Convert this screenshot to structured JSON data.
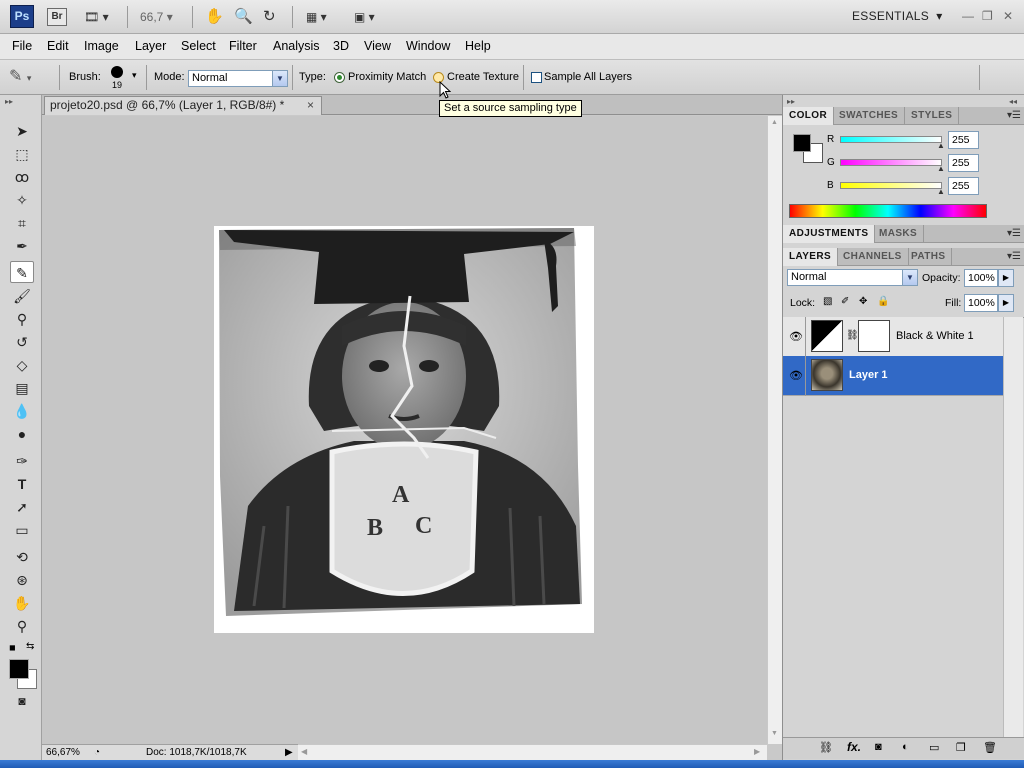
{
  "app": {
    "logo": "Ps",
    "bridge": "Br",
    "zoom_display": "66,7",
    "workspace": "ESSENTIALS",
    "icons": [
      "film-icon",
      "hand-icon",
      "zoom-icon",
      "rotate-view-icon",
      "arrange-icon",
      "screen-mode-icon"
    ],
    "window_buttons": [
      "minimize",
      "restore",
      "close"
    ]
  },
  "menu": [
    "File",
    "Edit",
    "Image",
    "Layer",
    "Select",
    "Filter",
    "Analysis",
    "3D",
    "View",
    "Window",
    "Help"
  ],
  "options": {
    "brush_label": "Brush:",
    "brush_size": "19",
    "mode_label": "Mode:",
    "mode_value": "Normal",
    "type_label": "Type:",
    "proximity": "Proximity Match",
    "texture": "Create Texture",
    "sample_all": "Sample All Layers",
    "tooltip": "Set a source sampling type"
  },
  "document": {
    "tab_title": "projeto20.psd @ 66,7% (Layer 1, RGB/8#) *",
    "zoom": "66,67%",
    "doc_info": "Doc: 1018,7K/1018,7K",
    "photo_letters": [
      "A",
      "B",
      "C"
    ]
  },
  "panels": {
    "color_tabs": [
      "COLOR",
      "SWATCHES",
      "STYLES"
    ],
    "rgb": [
      {
        "label": "R",
        "value": "255",
        "color": "#00dede"
      },
      {
        "label": "G",
        "value": "255",
        "color": "#e000e0"
      },
      {
        "label": "B",
        "value": "255",
        "color": "#e0e000"
      }
    ],
    "adj_tabs": [
      "ADJUSTMENTS",
      "MASKS"
    ],
    "layer_tabs": [
      "LAYERS",
      "CHANNELS",
      "PATHS"
    ],
    "blend_mode": "Normal",
    "opacity_label": "Opacity:",
    "opacity": "100%",
    "lock_label": "Lock:",
    "fill_label": "Fill:",
    "fill": "100%",
    "layers": [
      {
        "name": "Black & White 1",
        "selected": false
      },
      {
        "name": "Layer 1",
        "selected": true
      }
    ],
    "bottom_icons": [
      "link-icon",
      "fx-icon",
      "mask-icon",
      "adjustment-icon",
      "group-icon",
      "new-layer-icon",
      "trash-icon"
    ]
  },
  "colors": {
    "accent": "#3169c6",
    "foreground": "#000000",
    "background": "#ffffff"
  }
}
